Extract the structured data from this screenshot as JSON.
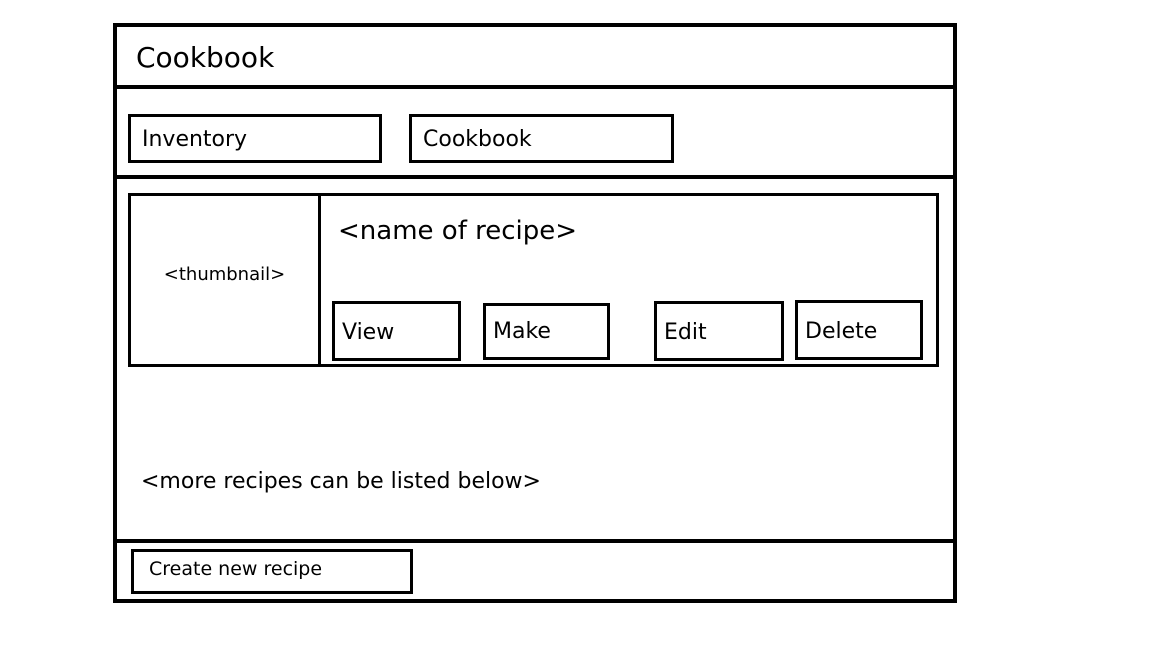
{
  "app": {
    "title": "Cookbook"
  },
  "nav": {
    "inventory_label": "Inventory",
    "cookbook_label": "Cookbook"
  },
  "recipes": [
    {
      "thumbnail": "<thumbnail>",
      "name": "<name of recipe>",
      "actions": {
        "view": "View",
        "make": "Make",
        "edit": "Edit",
        "delete": "Delete"
      }
    }
  ],
  "list": {
    "more_note": "<more recipes can be listed below>"
  },
  "footer": {
    "create_label": "Create new recipe"
  }
}
